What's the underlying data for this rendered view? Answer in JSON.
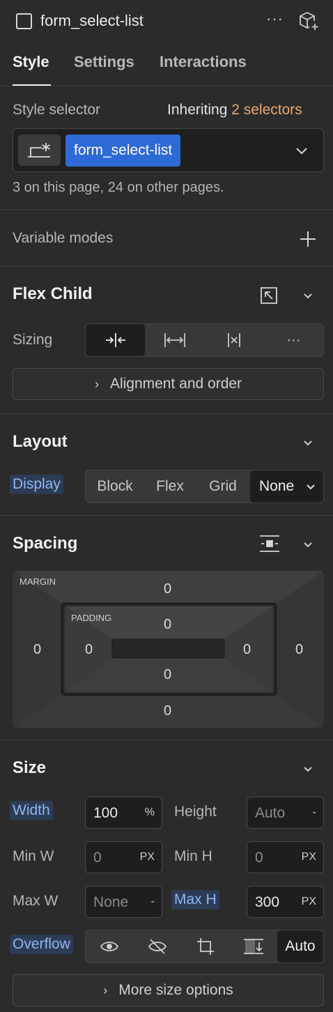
{
  "header": {
    "element_name": "form_select-list",
    "tabs": [
      "Style",
      "Settings",
      "Interactions"
    ],
    "active_tab": "Style"
  },
  "selector": {
    "label": "Style selector",
    "inheriting_prefix": "Inheriting",
    "inheriting_count": "2 selectors",
    "chip": "form_select-list",
    "usage": "3 on this page, 24 on other pages."
  },
  "variable_modes": {
    "label": "Variable modes"
  },
  "flex_child": {
    "title": "Flex Child",
    "sizing_label": "Sizing",
    "alignment_button": "Alignment and order"
  },
  "layout": {
    "title": "Layout",
    "display_label": "Display",
    "options": [
      "Block",
      "Flex",
      "Grid",
      "None"
    ],
    "active": "None"
  },
  "spacing": {
    "title": "Spacing",
    "margin_label": "MARGIN",
    "padding_label": "PADDING",
    "margin": {
      "top": "0",
      "right": "0",
      "bottom": "0",
      "left": "0"
    },
    "padding": {
      "top": "0",
      "right": "0",
      "bottom": "0",
      "left": "0"
    }
  },
  "size": {
    "title": "Size",
    "width_label": "Width",
    "width_value": "100",
    "width_unit": "%",
    "height_label": "Height",
    "height_value": "Auto",
    "height_unit": "-",
    "minw_label": "Min W",
    "minw_value": "0",
    "minw_unit": "PX",
    "minh_label": "Min H",
    "minh_value": "0",
    "minh_unit": "PX",
    "maxw_label": "Max W",
    "maxw_value": "None",
    "maxw_unit": "-",
    "maxh_label": "Max H",
    "maxh_value": "300",
    "maxh_unit": "PX",
    "overflow_label": "Overflow",
    "overflow_active": "Auto",
    "more_button": "More size options"
  },
  "colors": {
    "accent_blue": "#2d6ad6",
    "inherit_orange": "#e8a86a",
    "highlight_text": "#8fb6f2"
  }
}
